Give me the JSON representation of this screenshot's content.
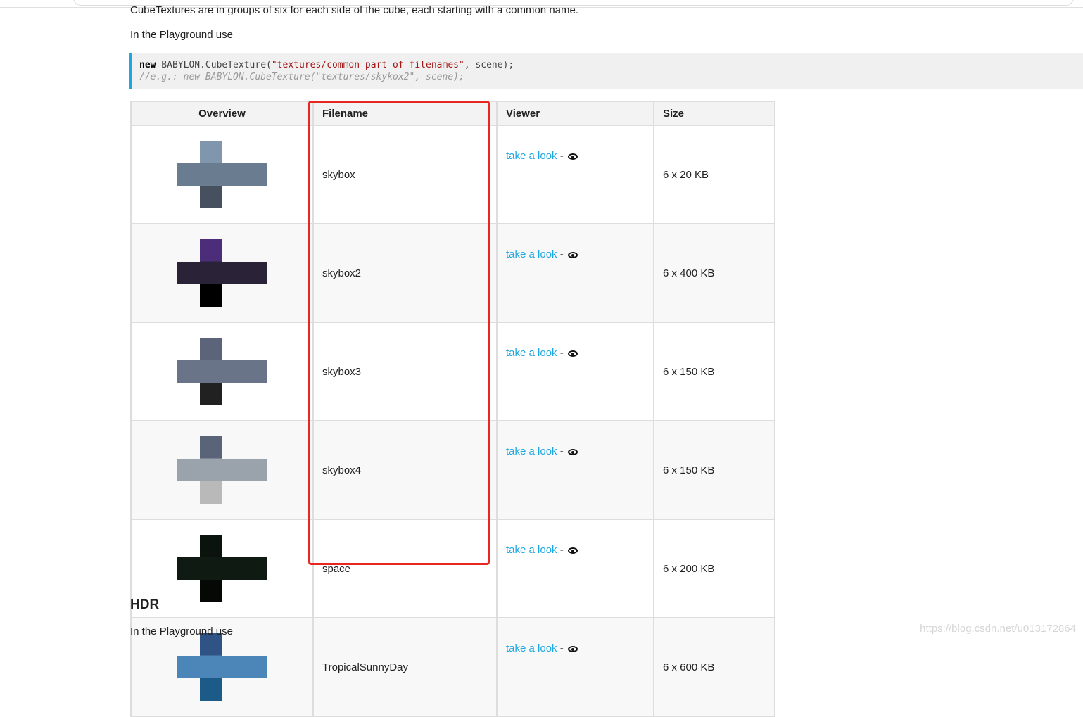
{
  "intro_text": "CubeTextures are in groups of six for each side of the cube, each starting with a common name.",
  "playground_text": "In the Playground use",
  "code": {
    "line1_keyword": "new",
    "line1_call": " BABYLON.CubeTexture(",
    "line1_string": "\"textures/common part of filenames\"",
    "line1_end": ", scene);",
    "line2_comment": "//e.g.: new BABYLON.CubeTexture(\"textures/skykox2\", scene);"
  },
  "table": {
    "headers": [
      "Overview",
      "Filename",
      "Viewer",
      "Size"
    ],
    "viewer_link_label": "take a look",
    "viewer_separator": "-",
    "viewer_icon": "eye-icon",
    "rows": [
      {
        "filename": "skybox",
        "size": "6 x 20 KB",
        "thumb": {
          "top": "#7f96ac",
          "band": "#6a7c8f",
          "bottom": "#47505e"
        }
      },
      {
        "filename": "skybox2",
        "size": "6 x 400 KB",
        "thumb": {
          "top": "#4b2d7a",
          "band": "#2a2236",
          "bottom": "#000000"
        }
      },
      {
        "filename": "skybox3",
        "size": "6 x 150 KB",
        "thumb": {
          "top": "#5b6478",
          "band": "#6a7488",
          "bottom": "#212121"
        }
      },
      {
        "filename": "skybox4",
        "size": "6 x 150 KB",
        "thumb": {
          "top": "#5a6478",
          "band": "#9aa2ac",
          "bottom": "#b9b9b9"
        }
      },
      {
        "filename": "space",
        "size": "6 x 200 KB",
        "thumb": {
          "top": "#0a140d",
          "band": "#0e1a12",
          "bottom": "#050805"
        }
      },
      {
        "filename": "TropicalSunnyDay",
        "size": "6 x 600 KB",
        "thumb": {
          "top": "#2f5384",
          "band": "#4c86b8",
          "bottom": "#1c5a87"
        }
      }
    ]
  },
  "hdr_heading": "HDR",
  "watermark": "https://blog.csdn.net/u013172864",
  "colors": {
    "link": "#1ea7e0",
    "highlight": "#e8281f",
    "code_border": "#1ea7e0"
  }
}
